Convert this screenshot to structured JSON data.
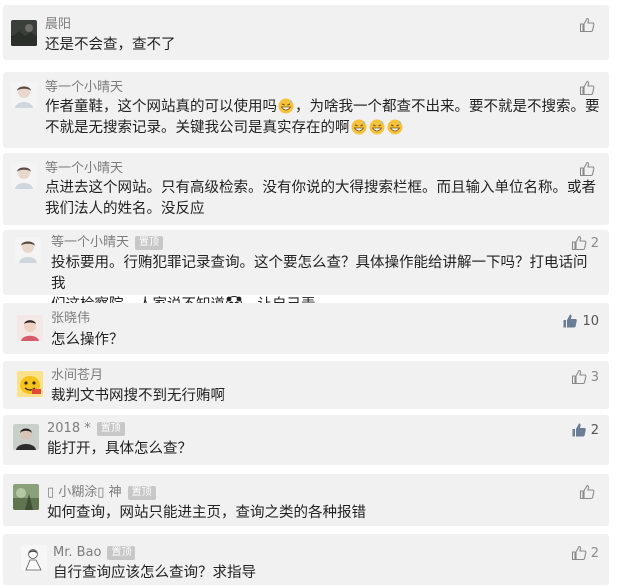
{
  "comments": [
    {
      "name": "晨阳",
      "pinned": false,
      "avatar": "avatar-dark-landscape",
      "text": "还是不会查，查不了",
      "likes": "",
      "liked": false
    },
    {
      "name": "等一个小晴天",
      "pinned": false,
      "avatar": "avatar-girl-sketch",
      "line1": "作者童鞋，这个网站真的可以使用吗",
      "line1b": "，为啥我一个都查不出来。要不就是不搜索。要",
      "line2": "不就是无搜索记录。关键我公司是真实存在的啊",
      "likes": "",
      "liked": false
    },
    {
      "name": "等一个小晴天",
      "pinned": false,
      "avatar": "avatar-girl-sketch",
      "line1": "点进去这个网站。只有高级检索。没有你说的大得搜索栏框。而且输入单位名称。或者",
      "line2": "我们法人的姓名。没反应",
      "likes": "",
      "liked": false
    },
    {
      "name": "等一个小晴天",
      "pinned": true,
      "pin_label": "置顶",
      "avatar": "avatar-girl-sketch",
      "line1": "投标要用。行贿犯罪记录查询。这个要怎么查？具体操作能给讲解一下吗？打电话问我",
      "line2a": "们这检察院。人家说不知道",
      "line2b": "。让自己弄",
      "likes": "2",
      "liked": false
    },
    {
      "name": "张晓伟",
      "pinned": false,
      "avatar": "avatar-boy-photo",
      "text": "怎么操作？",
      "likes": "10",
      "liked": true
    },
    {
      "name": "水间苍月",
      "pinned": false,
      "avatar": "avatar-yellow-cartoon",
      "text": "裁判文书网搜不到无行贿啊",
      "likes": "3",
      "liked": false
    },
    {
      "name": "2018 *",
      "pinned": true,
      "pin_label": "置顶",
      "avatar": "avatar-person-photo",
      "text": "能打开，具体怎么查？",
      "likes": "2",
      "liked": true
    },
    {
      "name": "▯ 小糊涂▯ 神",
      "pinned": true,
      "pin_label": "置顶",
      "avatar": "avatar-nature-photo",
      "text": "如何查询，网站只能进主页，查询之类的各种报错",
      "likes": "",
      "liked": false
    },
    {
      "name": "Mr. Bao",
      "pinned": true,
      "pin_label": "置顶",
      "avatar": "avatar-sketch-person",
      "text": "自行查询应该怎么查询？求指导",
      "likes": "2",
      "liked": false
    }
  ]
}
